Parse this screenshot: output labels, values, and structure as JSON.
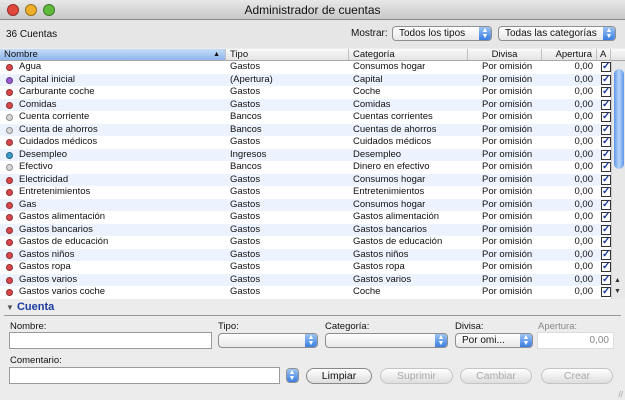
{
  "window": {
    "title": "Administrador de cuentas"
  },
  "toolbar": {
    "count": "36 Cuentas",
    "show_label": "Mostrar:",
    "type_filter": "Todos los tipos",
    "category_filter": "Todas las categorías"
  },
  "table": {
    "columns": [
      "Nombre",
      "Tipo",
      "Categoría",
      "Divisa",
      "Apertura",
      "A"
    ],
    "sorted_column": "Nombre",
    "rows": [
      {
        "name": "Agua",
        "type": "Gastos",
        "category": "Consumos hogar",
        "currency": "Por omisión",
        "opening": "0,00",
        "active": true,
        "icon": "#d9474a"
      },
      {
        "name": "Capital inicial",
        "type": "(Apertura)",
        "category": "Capital",
        "currency": "Por omisión",
        "opening": "0,00",
        "active": true,
        "icon": "#9b5bd0"
      },
      {
        "name": "Carburante coche",
        "type": "Gastos",
        "category": "Coche",
        "currency": "Por omisión",
        "opening": "0,00",
        "active": true,
        "icon": "#d9474a"
      },
      {
        "name": "Comidas",
        "type": "Gastos",
        "category": "Comidas",
        "currency": "Por omisión",
        "opening": "0,00",
        "active": true,
        "icon": "#d9474a"
      },
      {
        "name": "Cuenta corriente",
        "type": "Bancos",
        "category": "Cuentas corrientes",
        "currency": "Por omisión",
        "opening": "0,00",
        "active": true,
        "icon": "#d8d8d8"
      },
      {
        "name": "Cuenta de ahorros",
        "type": "Bancos",
        "category": "Cuentas de ahorros",
        "currency": "Por omisión",
        "opening": "0,00",
        "active": true,
        "icon": "#d8d8d8"
      },
      {
        "name": "Cuidados médicos",
        "type": "Gastos",
        "category": "Cuidados médicos",
        "currency": "Por omisión",
        "opening": "0,00",
        "active": true,
        "icon": "#d9474a"
      },
      {
        "name": "Desempleo",
        "type": "Ingresos",
        "category": "Desempleo",
        "currency": "Por omisión",
        "opening": "0,00",
        "active": true,
        "icon": "#3a9cc8"
      },
      {
        "name": "Efectivo",
        "type": "Bancos",
        "category": "Dinero en efectivo",
        "currency": "Por omisión",
        "opening": "0,00",
        "active": true,
        "icon": "#d8d8d8"
      },
      {
        "name": "Electricidad",
        "type": "Gastos",
        "category": "Consumos hogar",
        "currency": "Por omisión",
        "opening": "0,00",
        "active": true,
        "icon": "#d9474a"
      },
      {
        "name": "Entretenimientos",
        "type": "Gastos",
        "category": "Entretenimientos",
        "currency": "Por omisión",
        "opening": "0,00",
        "active": true,
        "icon": "#d9474a"
      },
      {
        "name": "Gas",
        "type": "Gastos",
        "category": "Consumos hogar",
        "currency": "Por omisión",
        "opening": "0,00",
        "active": true,
        "icon": "#d9474a"
      },
      {
        "name": "Gastos alimentación",
        "type": "Gastos",
        "category": "Gastos alimentación",
        "currency": "Por omisión",
        "opening": "0,00",
        "active": true,
        "icon": "#d9474a"
      },
      {
        "name": "Gastos bancarios",
        "type": "Gastos",
        "category": "Gastos bancarios",
        "currency": "Por omisión",
        "opening": "0,00",
        "active": true,
        "icon": "#d9474a"
      },
      {
        "name": "Gastos de educación",
        "type": "Gastos",
        "category": "Gastos de educación",
        "currency": "Por omisión",
        "opening": "0,00",
        "active": true,
        "icon": "#d9474a"
      },
      {
        "name": "Gastos niños",
        "type": "Gastos",
        "category": "Gastos niños",
        "currency": "Por omisión",
        "opening": "0,00",
        "active": true,
        "icon": "#d9474a"
      },
      {
        "name": "Gastos ropa",
        "type": "Gastos",
        "category": "Gastos ropa",
        "currency": "Por omisión",
        "opening": "0,00",
        "active": true,
        "icon": "#d9474a"
      },
      {
        "name": "Gastos varios",
        "type": "Gastos",
        "category": "Gastos varios",
        "currency": "Por omisión",
        "opening": "0,00",
        "active": true,
        "icon": "#d9474a"
      },
      {
        "name": "Gastos varios coche",
        "type": "Gastos",
        "category": "Coche",
        "currency": "Por omisión",
        "opening": "0,00",
        "active": true,
        "icon": "#d9474a"
      }
    ]
  },
  "form": {
    "section_title": "Cuenta",
    "name_label": "Nombre:",
    "name_value": "",
    "type_label": "Tipo:",
    "type_value": "",
    "category_label": "Categoría:",
    "category_value": "",
    "currency_label": "Divisa:",
    "currency_value": "Por omi...",
    "opening_label": "Apertura:",
    "opening_value": "0,00",
    "comment_label": "Comentario:",
    "comment_value": "",
    "clear_button": "Limpiar",
    "delete_button": "Suprimir",
    "change_button": "Cambiar",
    "create_button": "Crear"
  }
}
